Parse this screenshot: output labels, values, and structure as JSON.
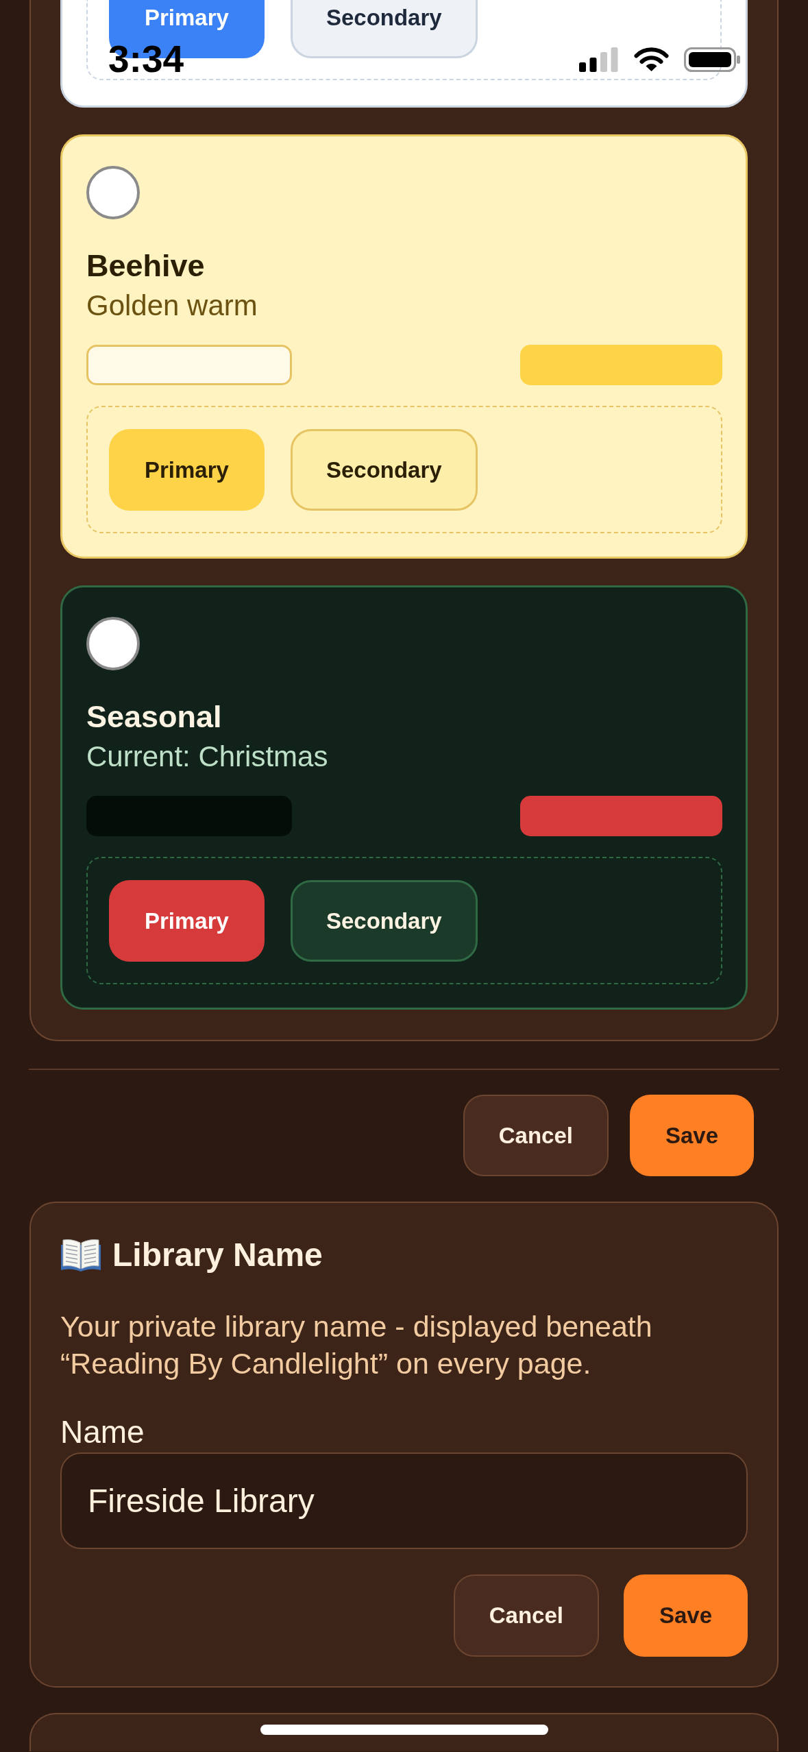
{
  "status_bar": {
    "time": "3:34"
  },
  "themes": [
    {
      "kind": "light",
      "buttons": [
        {
          "kind": "primary",
          "label": "Primary"
        },
        {
          "kind": "secondary",
          "label": "Secondary"
        }
      ]
    },
    {
      "kind": "honey",
      "selected": false,
      "name": "Beehive",
      "description": "Golden warm",
      "swatches": [
        {
          "color": "#fff9e7"
        },
        {
          "color": "#fed447"
        }
      ],
      "buttons": [
        {
          "kind": "primary",
          "label": "Primary"
        },
        {
          "kind": "secondary",
          "label": "Secondary"
        }
      ]
    },
    {
      "kind": "forest",
      "selected": false,
      "name": "Seasonal",
      "description": "Current: Christmas",
      "swatches": [
        {
          "color": "#040d08"
        },
        {
          "color": "#d63a3b"
        }
      ],
      "buttons": [
        {
          "kind": "primary",
          "label": "Primary"
        },
        {
          "kind": "secondary",
          "label": "Secondary"
        }
      ]
    }
  ],
  "theme_actions": [
    {
      "kind": "cancel",
      "label": "Cancel"
    },
    {
      "kind": "save",
      "label": "Save"
    }
  ],
  "library_name": {
    "title": "Library Name",
    "description": "Your private library name - displayed beneath “Reading By Candlelight” on every page.",
    "field": {
      "label": "Name",
      "value": "Fireside Library"
    },
    "actions": [
      {
        "kind": "cancel",
        "label": "Cancel"
      },
      {
        "kind": "save",
        "label": "Save"
      }
    ]
  }
}
